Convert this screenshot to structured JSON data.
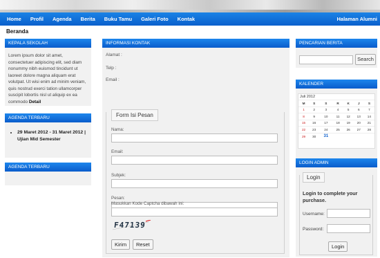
{
  "nav": {
    "items": [
      "Home",
      "Profil",
      "Agenda",
      "Berita",
      "Buku Tamu",
      "Galeri Foto",
      "Kontak"
    ],
    "right_link": "Halaman Alumni"
  },
  "breadcrumb": "Beranda",
  "kepala": {
    "title": "KEPALA SEKOLAH",
    "text": "Lorem ipsum dolor sit amet, consectetuer adipiscing elit, sed diam nonummy nibh euismod tincidunt ut laoreet dolore magna aliquam erat volutpat. Ut wisi enim ad minim veniam, quis nostrud exerci tation ullamcorper suscipit lobortis nisl ut aliquip ex ea commodo",
    "detail": "Detail"
  },
  "agenda_terbaru": {
    "title": "AGENDA TERBARU",
    "item": "29 Maret 2012 - 31 Maret 2012 | Ujian Mid Semester"
  },
  "agenda_terbaru2": {
    "title": "AGENDA TERBARU"
  },
  "info": {
    "title": "INFORMASI KONTAK",
    "alamat": "Alamat :",
    "telp": "Telp :",
    "email": "Email :",
    "form_legend": "Form Isi Pesan",
    "nama_label": "Nama:",
    "email_label": "Email:",
    "subjek_label": "Subjek:",
    "pesan_label": "Pesan:",
    "captcha_label": "Masukkan Kode Captcha dibawah ini:",
    "captcha_code": "F47139",
    "kirim": "Kirim",
    "reset": "Reset"
  },
  "pencarian": {
    "title": "PENCARIAN BERITA",
    "button": "Search"
  },
  "kalender": {
    "title": "KALENDER",
    "month": "Juli 2012",
    "days": [
      "M",
      "S",
      "S",
      "R",
      "K",
      "J",
      "S"
    ],
    "weeks": [
      [
        "1",
        "2",
        "3",
        "4",
        "5",
        "6",
        "7"
      ],
      [
        "8",
        "9",
        "10",
        "11",
        "12",
        "13",
        "14"
      ],
      [
        "15",
        "16",
        "17",
        "18",
        "19",
        "20",
        "21"
      ],
      [
        "22",
        "23",
        "24",
        "25",
        "26",
        "27",
        "28"
      ],
      [
        "29",
        "30",
        "31",
        "",
        "",
        "",
        ""
      ]
    ],
    "today": "31"
  },
  "login": {
    "title": "LOGIN ADMIN",
    "legend": "Login",
    "text": "Login to complete your purchase.",
    "username": "Username:",
    "password": "Password:",
    "button": "Login"
  },
  "colors": {
    "nav_blue": "#0a5fcc",
    "box_bg": "#f1f1f1"
  }
}
